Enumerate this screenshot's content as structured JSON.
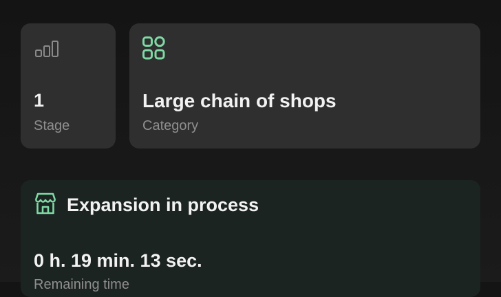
{
  "stage_card": {
    "icon": "signal-bars-icon",
    "value": "1",
    "label": "Stage"
  },
  "category_card": {
    "icon": "grid-apps-icon",
    "value": "Large chain of shops",
    "label": "Category"
  },
  "expansion_card": {
    "icon": "storefront-icon",
    "title": "Expansion in process",
    "timer": "0 h. 19 min. 13 sec.",
    "sublabel": "Remaining time"
  },
  "colors": {
    "background": "#181818",
    "card": "#2f2f2f",
    "expansion_card": "#1c2421",
    "accent_green": "#7ed9a4",
    "muted_icon": "#8a8a8a",
    "text_primary": "#f2f2f2",
    "text_secondary": "#8f8f8f"
  }
}
